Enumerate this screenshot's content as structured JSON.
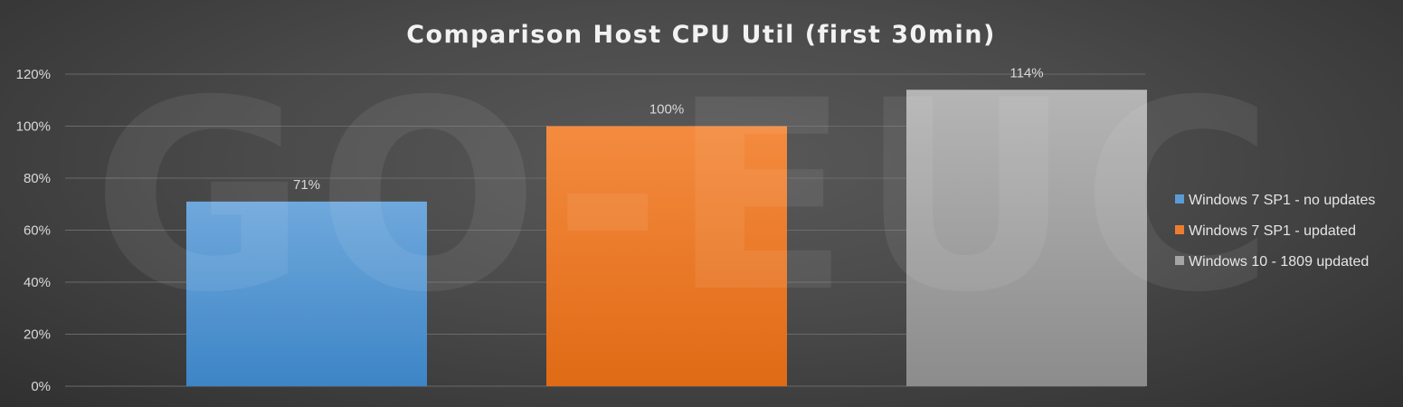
{
  "watermark": "GO-EUC",
  "chart_data": {
    "type": "bar",
    "title": "Comparison Host CPU Util (first 30min)",
    "xlabel": "",
    "ylabel": "",
    "ylim": [
      0,
      120
    ],
    "ytick_step": 20,
    "ytick_suffix": "%",
    "grid": true,
    "legend_position": "right",
    "series": [
      {
        "name": "Windows 7 SP1 - no updates",
        "value": 71,
        "label": "71%",
        "color": "#5b9bd5"
      },
      {
        "name": "Windows 7 SP1 - updated",
        "value": 100,
        "label": "100%",
        "color": "#ed7d31"
      },
      {
        "name": "Windows 10 - 1809 updated",
        "value": 114,
        "label": "114%",
        "color": "#a5a5a5"
      }
    ]
  }
}
